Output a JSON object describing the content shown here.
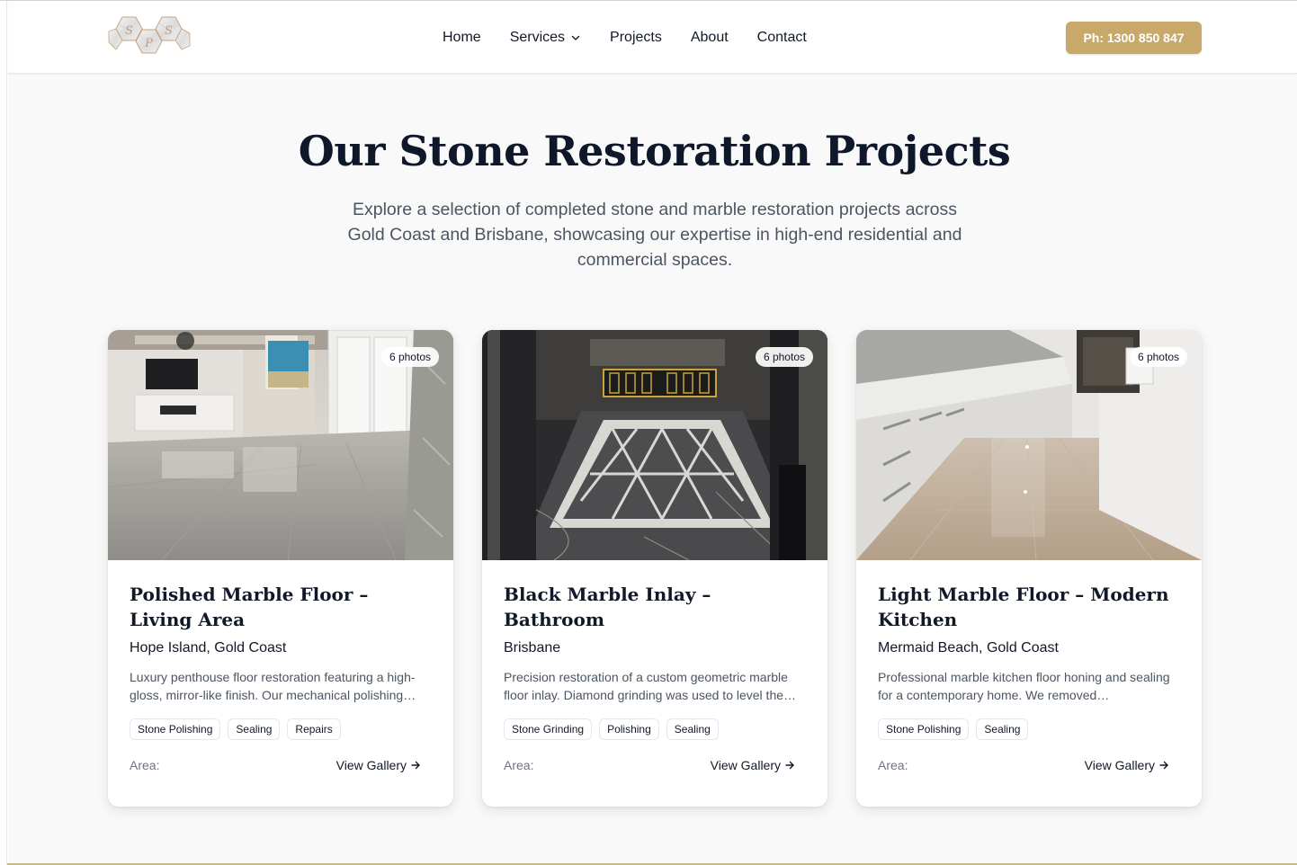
{
  "brand": {
    "logo_letters": [
      "S",
      "P",
      "S"
    ]
  },
  "nav": {
    "items": [
      {
        "label": "Home"
      },
      {
        "label": "Services",
        "has_dropdown": true
      },
      {
        "label": "Projects"
      },
      {
        "label": "About"
      },
      {
        "label": "Contact"
      }
    ],
    "phone_label": "Ph: 1300 850 847"
  },
  "hero": {
    "title": "Our Stone Restoration Projects",
    "subtitle": "Explore a selection of completed stone and marble restoration projects across Gold Coast and Brisbane, showcasing our expertise in high-end residential and commercial spaces."
  },
  "projects": [
    {
      "badge": "6 photos",
      "title": "Polished Marble Floor – Living Area",
      "location": "Hope Island, Gold Coast",
      "description": "Luxury penthouse floor restoration featuring a high-gloss, mirror-like finish. Our mechanical polishing…",
      "tags": [
        "Stone Polishing",
        "Sealing",
        "Repairs"
      ],
      "area_label": "Area:",
      "gallery_label": "View Gallery"
    },
    {
      "badge": "6 photos",
      "title": "Black Marble Inlay – Bathroom",
      "location": "Brisbane",
      "description": "Precision restoration of a custom geometric marble floor inlay. Diamond grinding was used to level the…",
      "tags": [
        "Stone Grinding",
        "Polishing",
        "Sealing"
      ],
      "area_label": "Area:",
      "gallery_label": "View Gallery"
    },
    {
      "badge": "6 photos",
      "title": "Light Marble Floor – Modern Kitchen",
      "location": "Mermaid Beach, Gold Coast",
      "description": "Professional marble kitchen floor honing and sealing for a contemporary home. We removed…",
      "tags": [
        "Stone Polishing",
        "Sealing"
      ],
      "area_label": "Area:",
      "gallery_label": "View Gallery"
    }
  ],
  "colors": {
    "accent": "#c8a96a",
    "heading": "#0f172a",
    "muted": "#4b5563"
  }
}
